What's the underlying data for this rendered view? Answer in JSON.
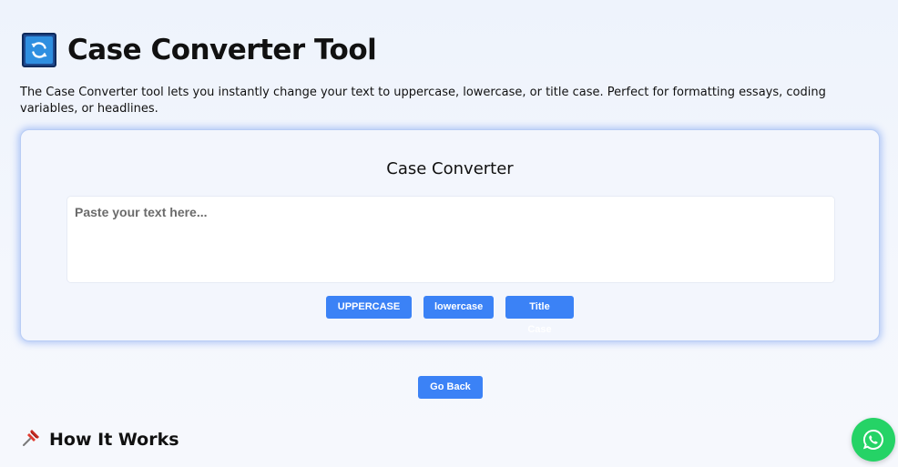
{
  "header": {
    "title": "Case Converter Tool",
    "icon": "refresh-icon"
  },
  "intro": {
    "text": "The Case Converter tool lets you instantly change your text to uppercase, lowercase, or title case. Perfect for formatting essays, coding variables, or headlines."
  },
  "converter": {
    "title": "Case Converter",
    "input_value": "",
    "input_placeholder": "Paste your text here...",
    "buttons": {
      "uppercase": "UPPERCASE",
      "lowercase": "lowercase",
      "titlecase": "Title Case"
    }
  },
  "navigation": {
    "go_back": "Go Back"
  },
  "how_it_works": {
    "title": "How It Works",
    "icon": "pushpin-icon"
  },
  "floating": {
    "icon": "whatsapp-icon"
  },
  "colors": {
    "accent": "#3b82f6",
    "whatsapp": "#25d366",
    "card_border": "#b9cdf5"
  }
}
